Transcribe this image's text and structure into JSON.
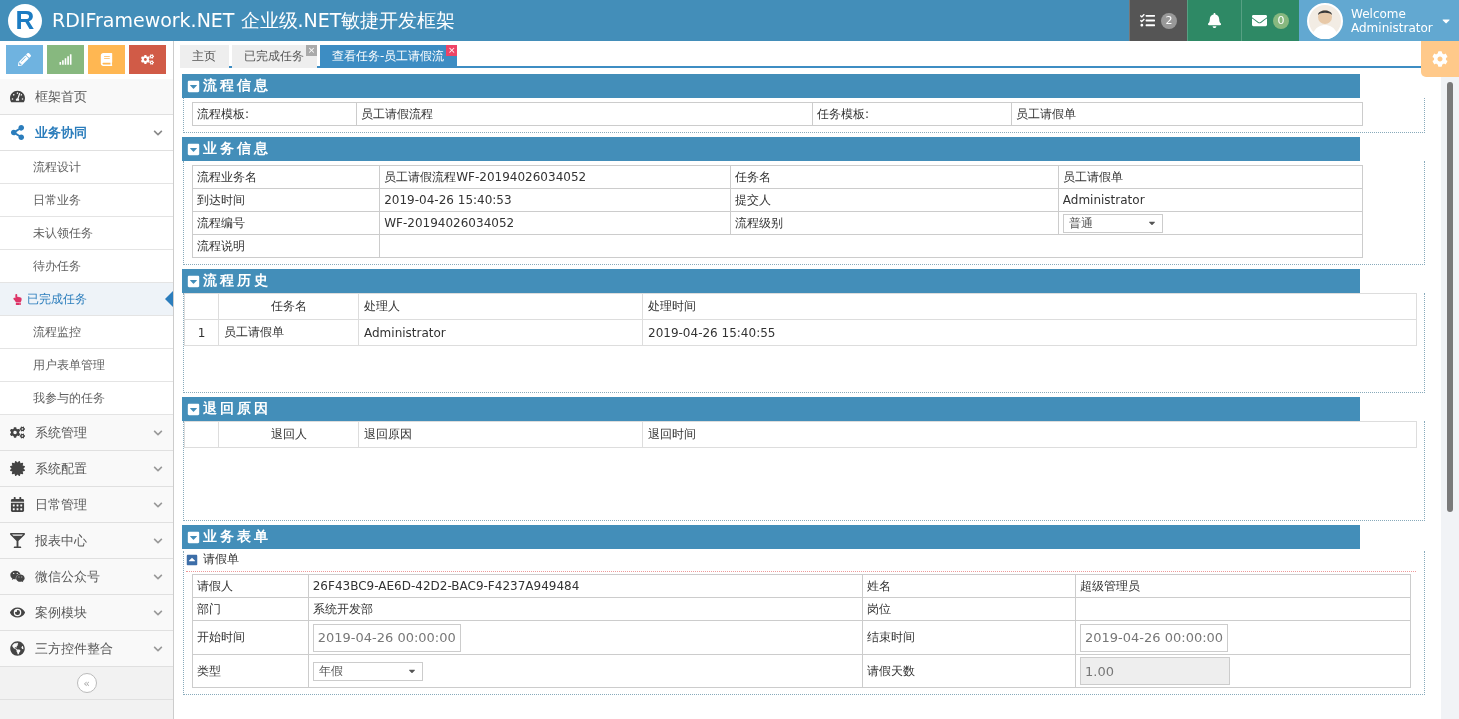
{
  "header": {
    "logo_text": "R",
    "title": "RDIFramework.NET 企业级.NET敏捷开发框架",
    "notifications": [
      {
        "kind": "tasks",
        "count": "2"
      },
      {
        "kind": "bell"
      },
      {
        "kind": "mail",
        "count": "0"
      }
    ],
    "user": {
      "greeting": "Welcome",
      "name": "Administrator"
    }
  },
  "shortcuts": [
    {
      "kind": "pencil",
      "color": "#6fb3e0"
    },
    {
      "kind": "signal",
      "color": "#87b87f"
    },
    {
      "kind": "book",
      "color": "#ffb752"
    },
    {
      "kind": "cogs",
      "color": "#d15b47"
    }
  ],
  "sidebar": {
    "items": [
      {
        "label": "框架首页",
        "selected": false
      },
      {
        "label": "业务协同",
        "expanded": true,
        "selected": true,
        "children": [
          {
            "label": "流程设计",
            "selected": false
          },
          {
            "label": "日常业务",
            "selected": false
          },
          {
            "label": "未认领任务",
            "selected": false
          },
          {
            "label": "待办任务",
            "selected": false
          },
          {
            "label": "已完成任务",
            "selected": true
          },
          {
            "label": "流程监控",
            "selected": false
          },
          {
            "label": "用户表单管理",
            "selected": false
          },
          {
            "label": "我参与的任务",
            "selected": false
          }
        ]
      },
      {
        "label": "系统管理",
        "selected": false
      },
      {
        "label": "系统配置",
        "selected": false
      },
      {
        "label": "日常管理",
        "selected": false
      },
      {
        "label": "报表中心",
        "selected": false
      },
      {
        "label": "微信公众号",
        "selected": false
      },
      {
        "label": "案例模块",
        "selected": false
      },
      {
        "label": "三方控件整合",
        "selected": false
      }
    ],
    "collapse_glyph": "«"
  },
  "tabs": [
    {
      "label": "主页",
      "selected": false
    },
    {
      "label": "已完成任务",
      "selected": false,
      "close_glyph": "×"
    },
    {
      "label": "查看任务-员工请假流",
      "selected": true,
      "close_glyph": "×"
    }
  ],
  "sections": [
    {
      "kind": "fields",
      "title": "流程信息",
      "rows": [
        [
          {
            "kind": "label",
            "text": "流程模板:"
          },
          {
            "kind": "text",
            "text": "员工请假流程"
          },
          {
            "kind": "label",
            "text": "任务模板:"
          },
          {
            "kind": "text",
            "text": "员工请假单"
          }
        ]
      ]
    },
    {
      "kind": "fields",
      "title": "业务信息",
      "rows": [
        [
          {
            "kind": "label",
            "text": "流程业务名"
          },
          {
            "kind": "text",
            "text": "员工请假流程WF-20194026034052"
          },
          {
            "kind": "label",
            "text": "任务名"
          },
          {
            "kind": "text",
            "text": "员工请假单"
          }
        ],
        [
          {
            "kind": "label",
            "text": "到达时间"
          },
          {
            "kind": "text",
            "text": "2019-04-26 15:40:53"
          },
          {
            "kind": "label",
            "text": "提交人"
          },
          {
            "kind": "text",
            "text": "Administrator"
          }
        ],
        [
          {
            "kind": "label",
            "text": "流程编号"
          },
          {
            "kind": "text",
            "text": "WF-20194026034052"
          },
          {
            "kind": "label",
            "text": "流程级别"
          },
          {
            "kind": "select",
            "text": "普通"
          }
        ],
        [
          {
            "kind": "label",
            "text": "流程说明"
          },
          {
            "kind": "span"
          }
        ]
      ]
    },
    {
      "kind": "grid",
      "title": "流程历史",
      "columns": [
        "任务名",
        "处理人",
        "处理时间"
      ],
      "rows": [
        {
          "number": "1",
          "cells": [
            "员工请假单",
            "Administrator",
            "2019-04-26 15:40:55"
          ]
        }
      ]
    },
    {
      "kind": "grid",
      "title": "退回原因",
      "columns": [
        "退回人",
        "退回原因",
        "退回时间"
      ]
    },
    {
      "kind": "form",
      "title": "业务表单",
      "subtitle": "请假单",
      "expanded": true,
      "rows": [
        [
          {
            "kind": "label",
            "text": "请假人"
          },
          {
            "kind": "text",
            "text": "26F43BC9-AE6D-42D2-BAC9-F4237A949484"
          },
          {
            "kind": "label",
            "text": "姓名"
          },
          {
            "kind": "text",
            "text": "超级管理员"
          }
        ],
        [
          {
            "kind": "label",
            "text": "部门"
          },
          {
            "kind": "text",
            "text": "系统开发部"
          },
          {
            "kind": "label",
            "text": "岗位"
          },
          {
            "kind": "empty"
          }
        ],
        [
          {
            "kind": "label",
            "text": "开始时间"
          },
          {
            "kind": "date",
            "text": "2019-04-26 00:00:00"
          },
          {
            "kind": "label",
            "text": "结束时间"
          },
          {
            "kind": "date",
            "text": "2019-04-26 00:00:00"
          }
        ],
        [
          {
            "kind": "label",
            "text": "类型"
          },
          {
            "kind": "select",
            "text": "年假"
          },
          {
            "kind": "label",
            "text": "请假天数"
          },
          {
            "kind": "input",
            "text": "1.00"
          }
        ]
      ]
    }
  ]
}
